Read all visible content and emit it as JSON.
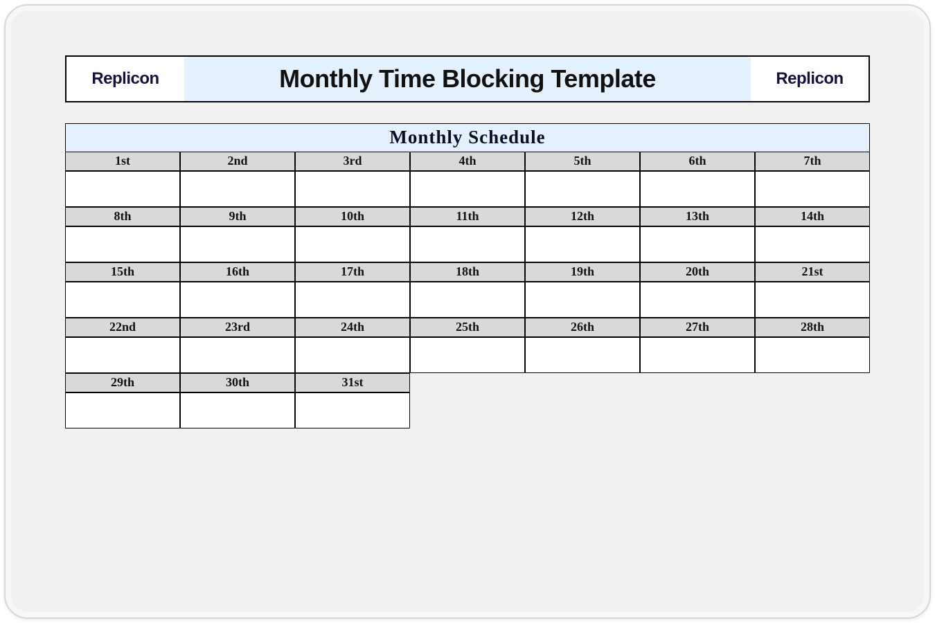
{
  "brand": {
    "left": "Replicon",
    "right": "Replicon"
  },
  "header": {
    "title": "Monthly Time Blocking Template"
  },
  "schedule": {
    "title": "Monthly  Schedule",
    "weeks": [
      [
        "1st",
        "2nd",
        "3rd",
        "4th",
        "5th",
        "6th",
        "7th"
      ],
      [
        "8th",
        "9th",
        "10th",
        "11th",
        "12th",
        "13th",
        "14th"
      ],
      [
        "15th",
        "16th",
        "17th",
        "18th",
        "19th",
        "20th",
        "21st"
      ],
      [
        "22nd",
        "23rd",
        "24th",
        "25th",
        "26th",
        "27th",
        "28th"
      ],
      [
        "29th",
        "30th",
        "31st"
      ]
    ]
  }
}
